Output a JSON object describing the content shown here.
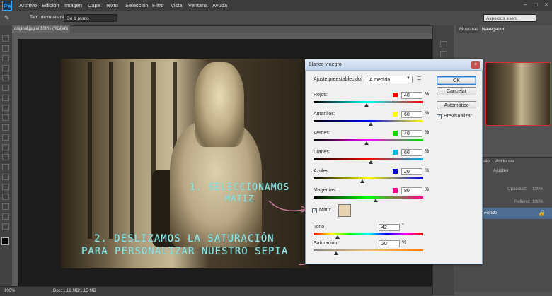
{
  "app": {
    "logo": "Ps"
  },
  "menu": [
    "Archivo",
    "Edición",
    "Imagen",
    "Capa",
    "Texto",
    "Selección",
    "Filtro",
    "Vista",
    "Ventana",
    "Ayuda"
  ],
  "window_controls": [
    "–",
    "□",
    "×"
  ],
  "options_bar": {
    "sample_label": "Tam. de muestra:",
    "sample_value": "De 1 punto",
    "workspace_value": "Aspectos esen."
  },
  "document": {
    "tab_title": "original.jpg al 100% (RGB/8)",
    "zoom": "100%",
    "doc_size": "Doc: 1,16 MB/1,15 MB"
  },
  "annotations": {
    "step1_line1": "1. SELECCIONAMOS",
    "step1_line2": "MATIZ",
    "step2_line1": "2. DESLIZAMOS LA SATURACIÓN",
    "step2_line2": "PARA PERSONALIZAR NUESTRO SEPIA"
  },
  "panels": {
    "tab_muestras": "Muestras",
    "tab_navegador": "Navegador",
    "tab_ajustes": "Ajustes",
    "tab_acciones": "Acciones",
    "tab_canales": "calo",
    "opacity_label": "Opacidad:",
    "opacity_value": "100%",
    "fill_label": "Relleno:",
    "fill_value": "100%",
    "layer_name": "Fondo"
  },
  "dialog": {
    "title": "Blanco y negro",
    "close": "×",
    "preset_label": "Ajuste preestablecido:",
    "preset_value": "A medida",
    "buttons": {
      "ok": "OK",
      "cancel": "Cancelar",
      "auto": "Automático"
    },
    "preview_label": "Previsualizar",
    "preview_checked": true,
    "channels": [
      {
        "label": "Rojos:",
        "value": "40",
        "color": "#ff0000"
      },
      {
        "label": "Amarillos:",
        "value": "60",
        "color": "#ffff00"
      },
      {
        "label": "Verdes:",
        "value": "40",
        "color": "#00e000"
      },
      {
        "label": "Cianes:",
        "value": "60",
        "color": "#00b4e6"
      },
      {
        "label": "Azules:",
        "value": "20",
        "color": "#0000e0"
      },
      {
        "label": "Magentas:",
        "value": "80",
        "color": "#ff0090"
      }
    ],
    "percent": "%",
    "tint_label": "Matiz",
    "tint_checked": true,
    "tint_color": "#e7d2b2",
    "hue_label": "Tono",
    "hue_value": "42",
    "hue_unit": "°",
    "sat_label": "Saturación",
    "sat_value": "20",
    "sat_unit": "%"
  }
}
